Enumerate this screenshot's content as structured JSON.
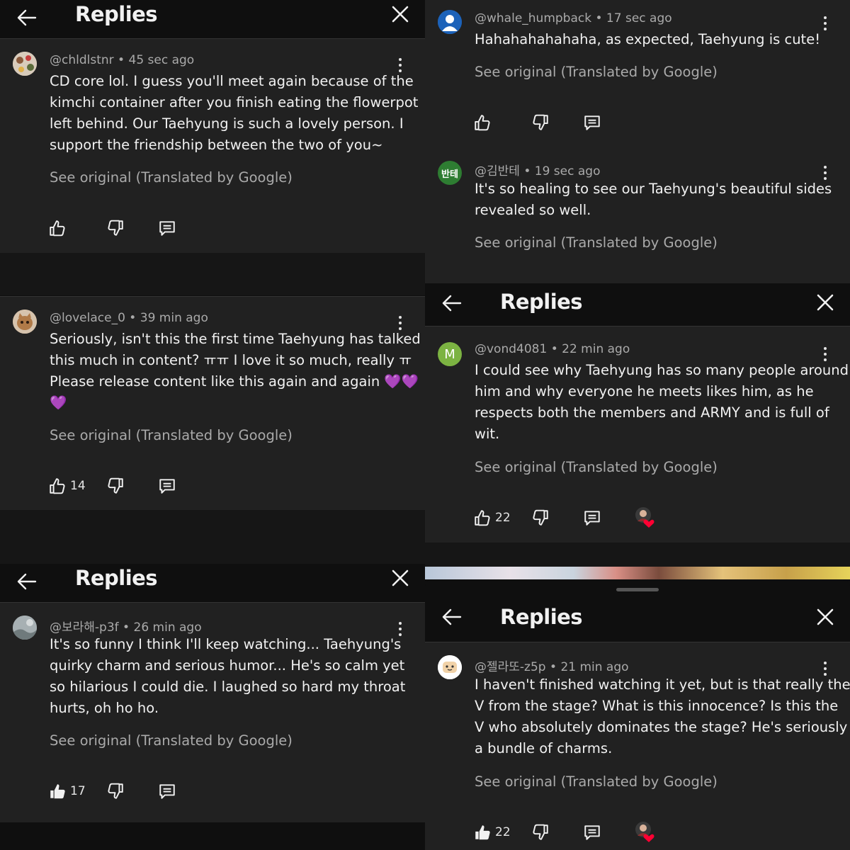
{
  "ui": {
    "header_title": "Replies",
    "see_original": "See original (Translated by Google)"
  },
  "colors": {
    "background": "#212121",
    "header": "#0f0f0f",
    "text": "#f1f1f1",
    "muted": "#aaaaaa",
    "heart": "#ff0033"
  },
  "comments": [
    {
      "handle": "@chldlstnr",
      "time": "45 sec ago",
      "lines": [
        "CD core lol. I guess you'll meet again because of the",
        "kimchi container after you finish eating the flowerpot",
        "left behind. Our Taehyung is such a lovely person. I",
        "support the friendship between the two of you~"
      ],
      "likes": ""
    },
    {
      "handle": "@lovelace_0",
      "time": "39 min ago",
      "lines": [
        "Seriously, isn't this the first time Taehyung has talked",
        "this much in content? ㅠㅠ I love it so much, really ㅠ",
        "Please release content like this again and again 💜💜",
        "💜"
      ],
      "likes": "14"
    },
    {
      "handle": "@보라해-p3f",
      "time": "26 min ago",
      "lines": [
        "It's so funny I think I'll keep watching... Taehyung's",
        "quirky charm and serious humor... He's so calm yet",
        "so hilarious I could die. I laughed so hard my throat",
        "hurts, oh ho ho."
      ],
      "likes": "17"
    },
    {
      "handle": "@whale_humpback",
      "time": "17 sec ago",
      "lines": [
        "Hahahahahahaha, as expected, Taehyung is cute!"
      ],
      "likes": ""
    },
    {
      "handle": "@김반테",
      "avatar_text": "반테",
      "time": "19 sec ago",
      "lines": [
        "It's so healing to see our Taehyung's beautiful sides",
        "revealed so well."
      ],
      "likes": ""
    },
    {
      "handle": "@vond4081",
      "avatar_text": "M",
      "time": "22 min ago",
      "lines": [
        "I could see why Taehyung has so many people around",
        "him and why everyone he meets likes him, as he",
        "respects both the members and ARMY and is full of",
        "wit."
      ],
      "likes": "22"
    },
    {
      "handle": "@젤라또-z5p",
      "time": "21 min ago",
      "lines": [
        "I haven't finished watching it yet, but is that really the",
        "V from the stage? What is this innocence? Is this the",
        "V who absolutely dominates the stage? He's seriously",
        "a bundle of charms."
      ],
      "likes": "22"
    }
  ]
}
